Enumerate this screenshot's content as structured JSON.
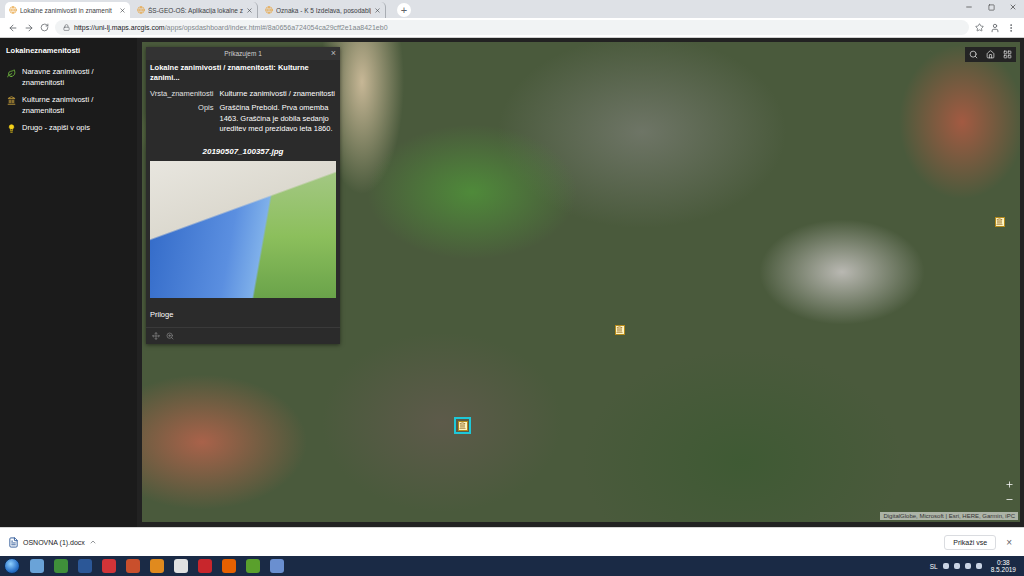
{
  "browser": {
    "tabs": [
      {
        "label": "Lokalne zanimivosti in znamenit",
        "selected": true
      },
      {
        "label": "ŠS-GEO-OŠ: Aplikacija lokalne z",
        "selected": false
      },
      {
        "label": "Oznaka - K 5 Izdelava, posodablj",
        "selected": false
      }
    ],
    "new_tab": "+",
    "url_host": "https://uni-lj.maps.arcgis.com",
    "url_path": "/apps/opsdashboard/index.html#/8a0656a724054ca29cff2e1aa8421eb0"
  },
  "sidebar": {
    "title": "Lokalneznamenitosti",
    "items": [
      {
        "label": "Naravne zanimivosti / znamenitosti",
        "kind": "nature"
      },
      {
        "label": "Kulturne zanimivosti / znamenitosti",
        "kind": "culture"
      },
      {
        "label": "Drugo - zapiši v opis",
        "kind": "other"
      }
    ]
  },
  "popup": {
    "header": "Prikazujem 1",
    "close": "×",
    "title": "Lokalne zanimivosti / znamenitosti: Kulturne zanimi...",
    "fields": [
      {
        "label": "Vrsta_znamenitosti",
        "value": "Kulturne zanimivosti / znamenitosti"
      },
      {
        "label": "Opis",
        "value": "Graščina Prebold. Prva omemba 1463. Graščina je dobila sedanjo ureditev med prezidavo leta 1860."
      }
    ],
    "image_caption": "20190507_100357.jpg",
    "attachments": "Priloge"
  },
  "map": {
    "markers": [
      {
        "selected": false
      },
      {
        "selected": true
      },
      {
        "selected": false
      }
    ],
    "attribution": "DigitalGlobe, Microsoft | Esri, HERE, Garmin, iPC"
  },
  "download_bar": {
    "file": "OSNOVNA (1).docx",
    "show_all": "Prikaži vse",
    "close": "×"
  },
  "taskbar": {
    "language": "SL",
    "time": "0:38",
    "date": "8.5.2019"
  }
}
